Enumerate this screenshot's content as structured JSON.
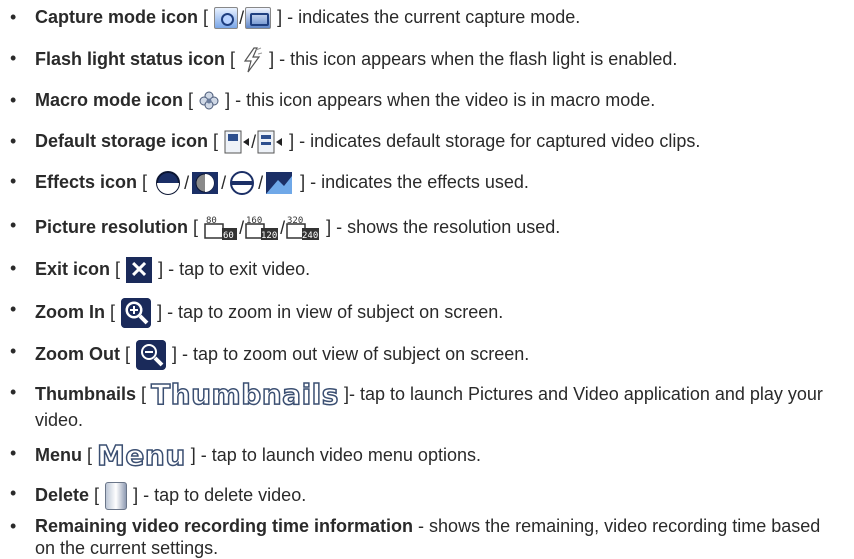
{
  "items": [
    {
      "title": "Capture mode icon",
      "desc": "] - indicates the current capture mode.",
      "icons": [
        "camera-icon",
        "video-camera-icon"
      ]
    },
    {
      "title": "Flash light status icon",
      "desc": "] - this icon appears when the flash light is enabled.",
      "icons": [
        "flash-icon"
      ]
    },
    {
      "title": "Macro mode icon",
      "desc": "] - this icon appears when the video is in macro mode.",
      "icons": [
        "macro-flower-icon"
      ]
    },
    {
      "title": "Default storage icon",
      "desc": "] - indicates default storage for captured video clips.",
      "icons": [
        "storage-main-icon",
        "storage-card-icon"
      ]
    },
    {
      "title": "Effects icon",
      "desc": "] - indicates the effects used.",
      "icons": [
        "effect-normal-icon",
        "effect-bw-icon",
        "effect-negative-icon",
        "effect-sepia-icon"
      ]
    },
    {
      "title": "Picture resolution",
      "desc": "] - shows the resolution used.",
      "resolutions": [
        {
          "top": "80",
          "bottom": "60"
        },
        {
          "top": "160",
          "bottom": "120"
        },
        {
          "top": "320",
          "bottom": "240"
        }
      ]
    },
    {
      "title": "Exit icon",
      "desc": "] - tap to exit video.",
      "icons": [
        "exit-icon"
      ]
    },
    {
      "title": "Zoom In",
      "desc": "] - tap to zoom in view of subject on screen.",
      "icons": [
        "zoom-in-icon"
      ]
    },
    {
      "title": "Zoom Out",
      "desc": "] - tap to zoom out view of subject on screen.",
      "icons": [
        "zoom-out-icon"
      ]
    },
    {
      "title": "Thumbnails",
      "icon_text": "Thumbnails",
      "desc": "]- tap to launch Pictures and Video application and play your video."
    },
    {
      "title": "Menu",
      "icon_text": "Menu",
      "desc": "] - tap to launch video menu options."
    },
    {
      "title": "Delete",
      "desc": "] - tap to delete video.",
      "icons": [
        "trash-can-icon"
      ]
    },
    {
      "title": "Remaining video recording time information",
      "desc": " - shows the remaining, video recording time based on the current settings."
    }
  ],
  "symbols": {
    "bullet": "•",
    "open_bracket": "[",
    "slash": "/",
    "close_x": "✕"
  },
  "colors": {
    "text": "#2a2a2a",
    "icon_dark_blue": "#1a2a5a",
    "icon_outline": "#3b4f72"
  }
}
